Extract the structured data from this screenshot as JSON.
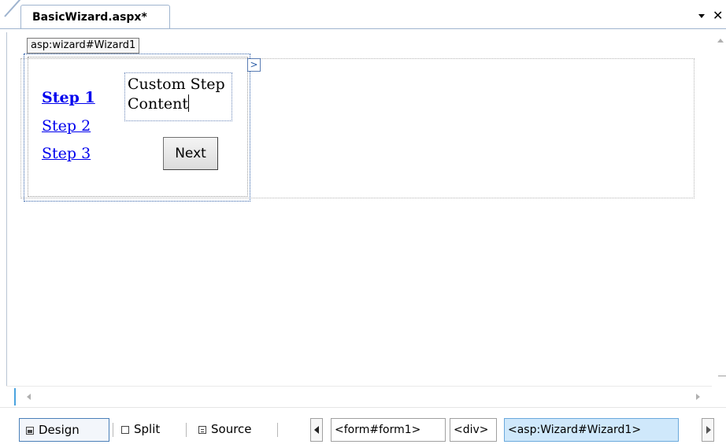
{
  "document": {
    "tab_title": "BasicWizard.aspx*"
  },
  "window_buttons": {
    "dropdown_icon": "chevron-down-icon",
    "close_symbol": "✕"
  },
  "designer": {
    "control_tag": "asp:wizard#Wizard1",
    "smart_tag_glyph": ">",
    "wizard": {
      "steps": [
        {
          "label": "Step 1",
          "active": true
        },
        {
          "label": "Step 2",
          "active": false
        },
        {
          "label": "Step 3",
          "active": false
        }
      ],
      "content": "Custom Step\nContent",
      "next_button": "Next"
    }
  },
  "view_buttons": {
    "design": "Design",
    "split": "Split",
    "source": "Source"
  },
  "breadcrumb": {
    "items": [
      "<form#form1>",
      "<div>",
      "<asp:Wizard#Wizard1>"
    ],
    "selected_index": 2
  },
  "colors": {
    "link": "#0000ee",
    "selection_border": "#2f5fa8",
    "selected_crumb": "#cfe8fb"
  }
}
